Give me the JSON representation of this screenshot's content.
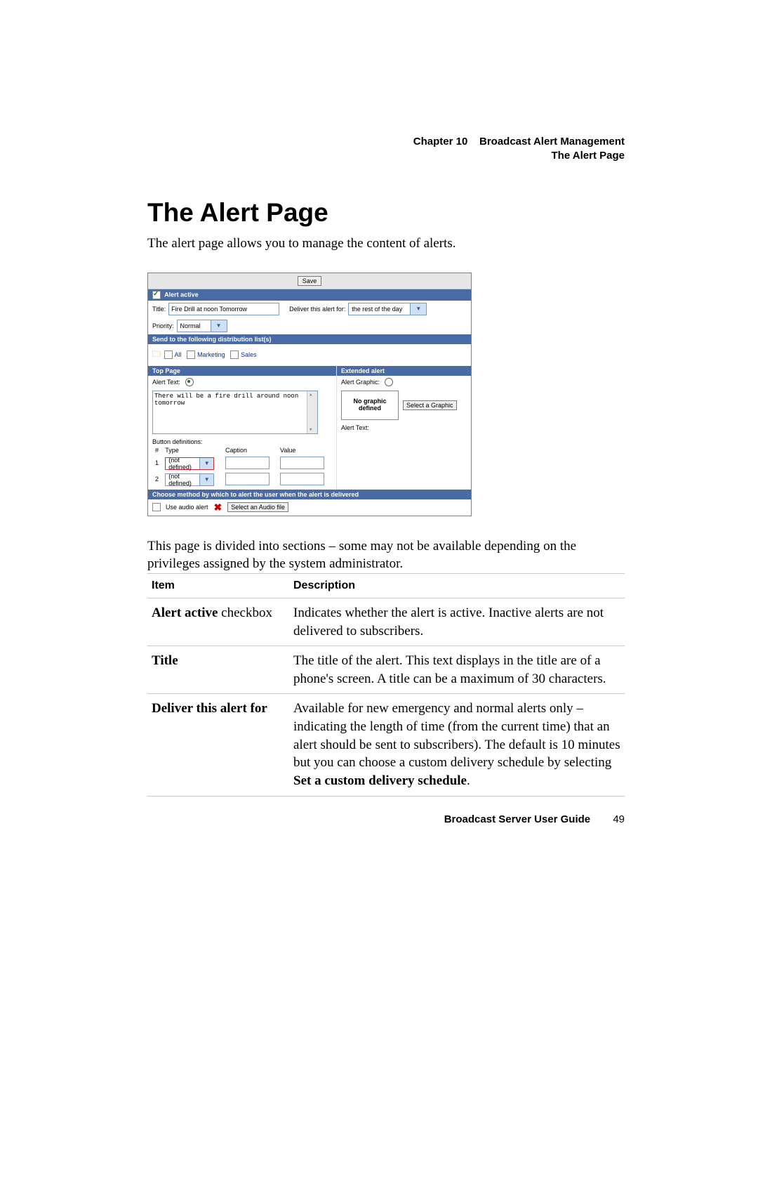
{
  "running_head": {
    "chapter_label": "Chapter 10",
    "chapter_title": "Broadcast Alert Management",
    "section": "The Alert Page"
  },
  "heading": "The Alert Page",
  "intro": "The alert page allows you to manage the content of alerts.",
  "screenshot": {
    "save": "Save",
    "alert_active_bar": "Alert active",
    "title_label": "Title:",
    "title_value": "Fire Drill at noon Tomorrow",
    "deliver_label": "Deliver this alert for:",
    "deliver_value": "the rest of the day",
    "priority_label": "Priority:",
    "priority_value": "Normal",
    "dist_bar": "Send to the following distribution list(s)",
    "dist": {
      "all": "All",
      "marketing": "Marketing",
      "sales": "Sales"
    },
    "top_page_bar": "Top Page",
    "ext_bar": "Extended alert",
    "alert_text_label": "Alert Text:",
    "alert_text_value": "There will be a fire drill around noon tomorrow",
    "alert_graphic_label": "Alert Graphic:",
    "no_graphic": "No graphic defined",
    "select_graphic": "Select a Graphic",
    "alert_text2": "Alert Text:",
    "button_defs": "Button definitions:",
    "bd_hash": "#",
    "bd_type": "Type",
    "bd_caption": "Caption",
    "bd_value": "Value",
    "row1_n": "1",
    "row2_n": "2",
    "not_defined": "(not defined)",
    "method_bar": "Choose method by which to alert the user when the alert is delivered",
    "use_audio": "Use audio alert",
    "select_audio": "Select an Audio file"
  },
  "para2": "This page is divided into sections – some may not be available depending on the privileges assigned by the system administrator.",
  "table": {
    "h_item": "Item",
    "h_desc": "Description",
    "rows": [
      {
        "item_bold": "Alert active",
        "item_rest": " checkbox",
        "desc": "Indicates whether the alert is active. Inactive alerts are not delivered to subscribers."
      },
      {
        "item_bold": "Title",
        "item_rest": "",
        "desc": "The title of the alert. This text displays in the title are of a phone's screen. A title can be a maximum of 30 characters."
      },
      {
        "item_bold": "Deliver this alert for",
        "item_rest": "",
        "desc": "Available for new emergency and normal alerts only – indicating the length of time (from the current time) that an alert should be sent to subscribers). The default is 10 minutes but you can choose a custom delivery schedule by selecting ",
        "desc_bold": "Set a custom delivery schedule",
        "desc_tail": "."
      }
    ]
  },
  "footer": {
    "guide": "Broadcast Server User Guide",
    "page": "49"
  }
}
